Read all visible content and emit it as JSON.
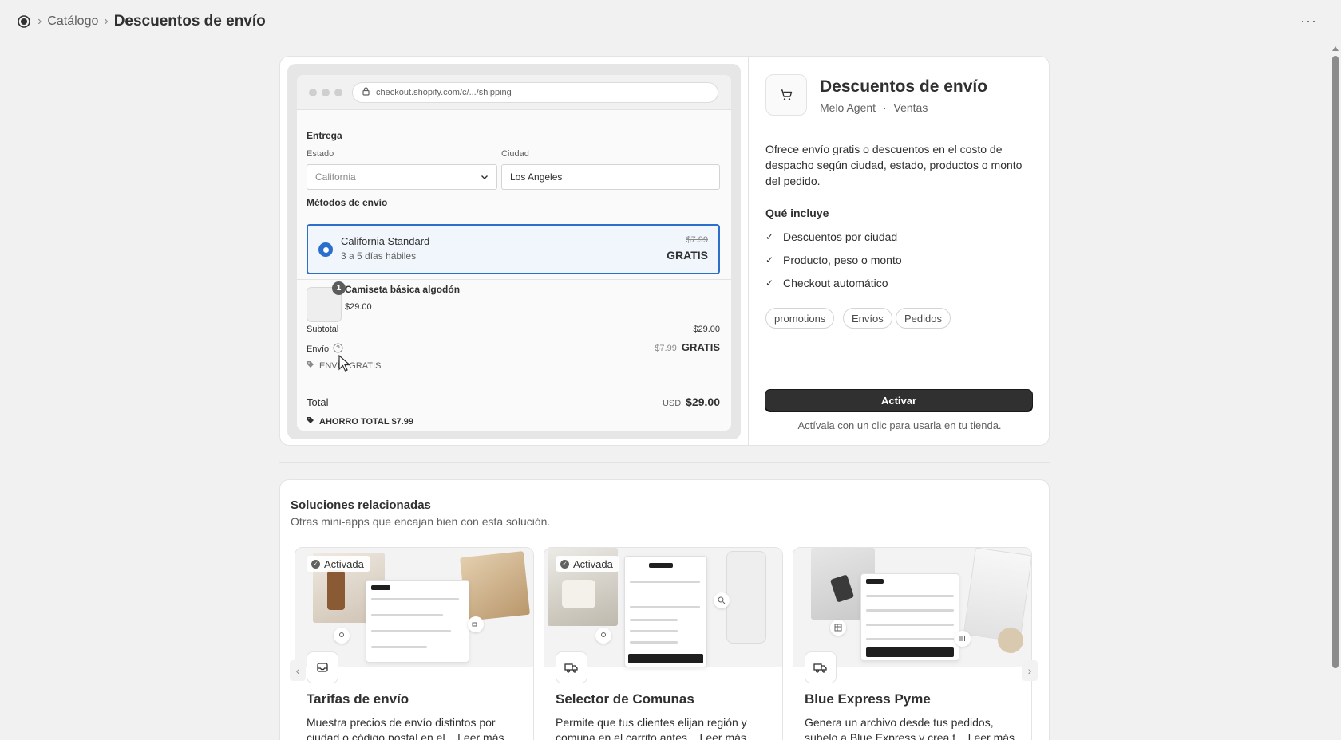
{
  "header": {
    "breadcrumb_catalog": "Catálogo",
    "breadcrumb_current": "Descuentos de envío",
    "more_label": "···",
    "separator": "›"
  },
  "preview": {
    "url": "checkout.shopify.com/c/.../shipping",
    "delivery_heading": "Entrega",
    "state_label": "Estado",
    "state_placeholder": "California",
    "city_label": "Ciudad",
    "city_value": "Los Angeles",
    "methods_heading": "Métodos de envío",
    "method_name": "California Standard",
    "method_eta": "3 a 5 días hábiles",
    "method_old_price": "$7.99",
    "method_price": "GRATIS",
    "product_qty": "1",
    "product_name": "Camiseta básica algodón",
    "product_price": "$29.00",
    "subtotal_label": "Subtotal",
    "subtotal_value": "$29.00",
    "shipping_label": "Envío",
    "shipping_old": "$7.99",
    "shipping_value": "GRATIS",
    "discount_tag": "ENVÍO GRATIS",
    "total_label": "Total",
    "currency": "USD",
    "total_value": "$29.00",
    "savings": "AHORRO TOTAL $7.99"
  },
  "info": {
    "title": "Descuentos de envío",
    "author": "Melo Agent",
    "dot": "·",
    "category": "Ventas",
    "description": "Ofrece envío gratis o descuentos en el costo de despacho según ciudad, estado, productos o monto del pedido.",
    "includes_heading": "Qué incluye",
    "includes": [
      "Descuentos por ciudad",
      "Producto, peso o monto",
      "Checkout automático"
    ],
    "check_glyph": "✓",
    "tags": [
      "promotions",
      "Envíos",
      "Pedidos"
    ],
    "activate_label": "Activar",
    "activate_note": "Actívala con un clic para usarla en tu tienda."
  },
  "related": {
    "title": "Soluciones relacionadas",
    "subtitle": "Otras mini-apps que encajan bien con esta solución.",
    "activated_label": "Activada",
    "cards": [
      {
        "title": "Tarifas de envío",
        "description": "Muestra precios de envío distintos por ciudad o código postal en el... Leer más"
      },
      {
        "title": "Selector de Comunas",
        "description": "Permite que tus clientes elijan región y comuna en el carrito antes... Leer más"
      },
      {
        "title": "Blue Express Pyme",
        "description": "Genera un archivo desde tus pedidos, súbelo a Blue Express y crea t... Leer más"
      }
    ],
    "prev_glyph": "‹",
    "next_glyph": "›"
  },
  "colors": {
    "accent_blue": "#2c6ecb",
    "primary_button": "#303030",
    "background": "#f1f1f1"
  },
  "icons": [
    "app-logo-icon",
    "more-icon",
    "lock-icon",
    "chevron-down-icon",
    "help-icon",
    "tag-icon",
    "cart-icon",
    "check-icon",
    "inbox-icon",
    "truck-icon"
  ]
}
